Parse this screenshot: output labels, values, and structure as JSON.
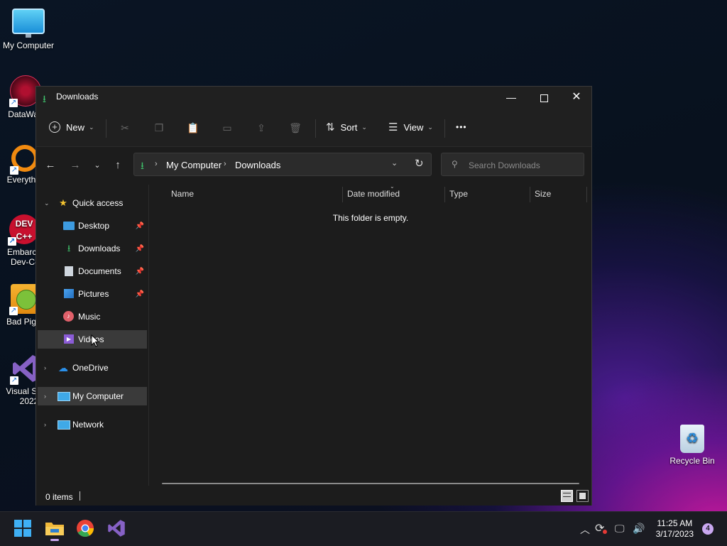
{
  "desktop": {
    "icons": [
      {
        "label": "My Computer",
        "label2": ""
      },
      {
        "label": "DataWag",
        "label2": ""
      },
      {
        "label": "Everyth",
        "label2": ""
      },
      {
        "label": "Embarca",
        "label2": "Dev-C-"
      },
      {
        "label": "Bad Pig",
        "label2": ""
      },
      {
        "label": "Visual St",
        "label2": "2022"
      },
      {
        "label": "Recycle Bin",
        "label2": ""
      }
    ]
  },
  "window": {
    "title": "Downloads",
    "toolbar": {
      "new_label": "New",
      "sort_label": "Sort",
      "view_label": "View",
      "more_label": "•••"
    },
    "address": {
      "crumbs": [
        "My Computer",
        "Downloads"
      ]
    },
    "search": {
      "placeholder": "Search Downloads"
    },
    "sidebar": {
      "quick_access": "Quick access",
      "items": [
        {
          "label": "Desktop"
        },
        {
          "label": "Downloads"
        },
        {
          "label": "Documents"
        },
        {
          "label": "Pictures"
        },
        {
          "label": "Music"
        },
        {
          "label": "Videos"
        }
      ],
      "onedrive": "OneDrive",
      "my_computer": "My Computer",
      "network": "Network"
    },
    "columns": {
      "name": "Name",
      "date_modified": "Date modified",
      "type": "Type",
      "size": "Size"
    },
    "empty_message": "This folder is empty.",
    "status": {
      "items": "0 items"
    }
  },
  "taskbar": {
    "time": "11:25 AM",
    "date": "3/17/2023",
    "notifications": "4"
  },
  "colors": {
    "accent": "#3fc26b",
    "selection": "#3a3a3a",
    "notification": "#c9a8f0"
  }
}
